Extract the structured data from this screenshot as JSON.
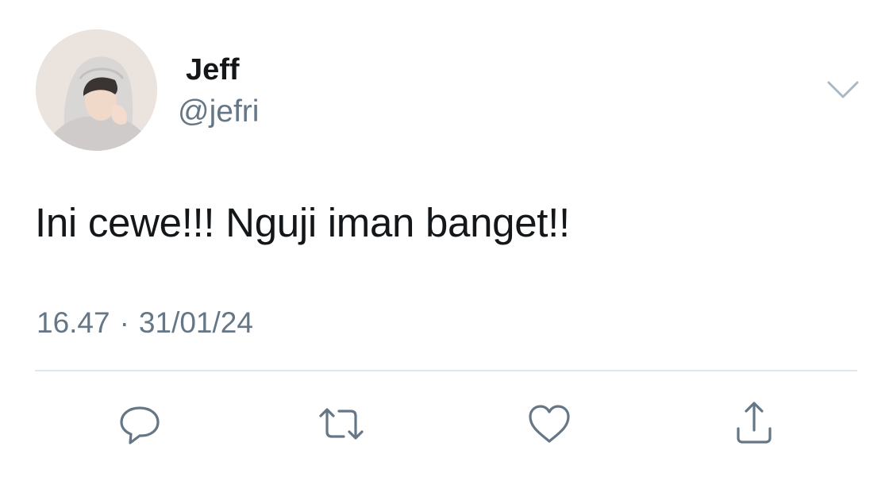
{
  "author": {
    "display_name": "Jeff",
    "handle": "@jefri"
  },
  "tweet": {
    "text": "Ini cewe!!! Nguji iman banget!!",
    "time": "16.47",
    "separator": "·",
    "date": "31/01/24"
  },
  "icons": {
    "menu": "chevron-down-icon",
    "reply": "reply-icon",
    "retweet": "retweet-icon",
    "like": "heart-icon",
    "share": "share-icon"
  },
  "colors": {
    "text_primary": "#14171a",
    "text_secondary": "#657786",
    "divider": "#e1e8ed",
    "action_icon": "#657786"
  }
}
